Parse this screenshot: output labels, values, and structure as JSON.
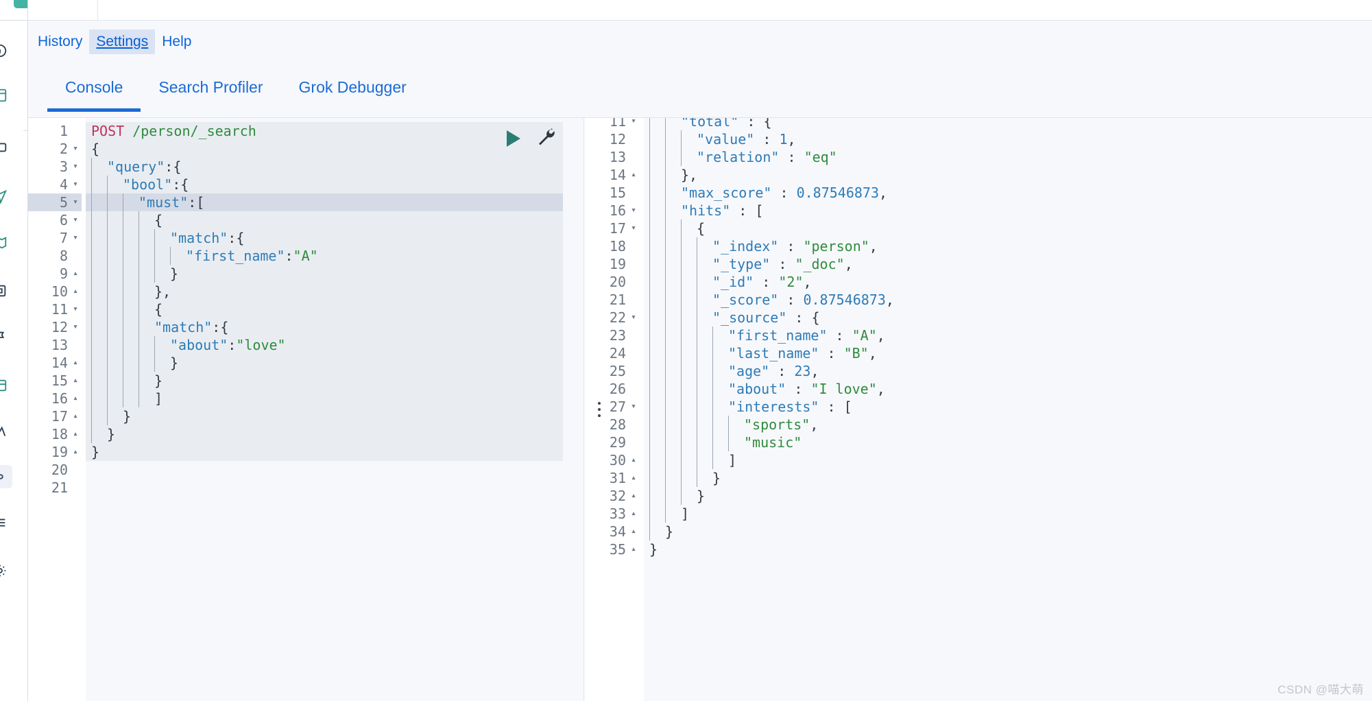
{
  "nav_rail": {
    "icons": [
      "info-icon",
      "dashboard-icon",
      "folder-icon",
      "send-icon",
      "maps-icon",
      "machine-learning-icon",
      "flag-icon",
      "canvas-icon",
      "uptime-icon",
      "devtools-icon",
      "stack-management-icon",
      "gear-icon"
    ]
  },
  "top_links": [
    {
      "label": "History",
      "selected": false
    },
    {
      "label": "Settings",
      "selected": true
    },
    {
      "label": "Help",
      "selected": false
    }
  ],
  "tabs": [
    {
      "label": "Console",
      "active": true
    },
    {
      "label": "Search Profiler",
      "active": false
    },
    {
      "label": "Grok Debugger",
      "active": false
    }
  ],
  "request_editor": {
    "actions": {
      "play": "play-icon",
      "wrench": "wrench-icon"
    },
    "highlight_line": 5,
    "lines": [
      {
        "n": 1,
        "fold": "",
        "indent": 0,
        "text": "POST /person/_search",
        "kind": "request-line"
      },
      {
        "n": 2,
        "fold": "▾",
        "indent": 0,
        "text": "{"
      },
      {
        "n": 3,
        "fold": "▾",
        "indent": 1,
        "text": "\"query\":{"
      },
      {
        "n": 4,
        "fold": "▾",
        "indent": 2,
        "text": "\"bool\":{"
      },
      {
        "n": 5,
        "fold": "▾",
        "indent": 3,
        "text": "\"must\":["
      },
      {
        "n": 6,
        "fold": "▾",
        "indent": 4,
        "text": "{"
      },
      {
        "n": 7,
        "fold": "▾",
        "indent": 5,
        "text": "\"match\":{"
      },
      {
        "n": 8,
        "fold": "",
        "indent": 6,
        "text": "\"first_name\":\"A\""
      },
      {
        "n": 9,
        "fold": "▴",
        "indent": 5,
        "text": "}"
      },
      {
        "n": 10,
        "fold": "▴",
        "indent": 4,
        "text": "},"
      },
      {
        "n": 11,
        "fold": "▾",
        "indent": 4,
        "text": "{"
      },
      {
        "n": 12,
        "fold": "▾",
        "indent": 4,
        "text": "\"match\":{"
      },
      {
        "n": 13,
        "fold": "",
        "indent": 5,
        "text": "\"about\":\"love\""
      },
      {
        "n": 14,
        "fold": "▴",
        "indent": 5,
        "text": "}"
      },
      {
        "n": 15,
        "fold": "▴",
        "indent": 4,
        "text": "}"
      },
      {
        "n": 16,
        "fold": "▴",
        "indent": 4,
        "text": "]"
      },
      {
        "n": 17,
        "fold": "▴",
        "indent": 2,
        "text": "}"
      },
      {
        "n": 18,
        "fold": "▴",
        "indent": 1,
        "text": "}"
      },
      {
        "n": 19,
        "fold": "▴",
        "indent": 0,
        "text": "}"
      },
      {
        "n": 20,
        "fold": "",
        "indent": 0,
        "text": ""
      },
      {
        "n": 21,
        "fold": "",
        "indent": 0,
        "text": ""
      }
    ]
  },
  "response_viewer": {
    "lines": [
      {
        "n": 11,
        "fold": "▾",
        "indent": 2,
        "text": "\"total\" : {",
        "clipped": true
      },
      {
        "n": 12,
        "fold": "",
        "indent": 3,
        "text": "\"value\" : 1,"
      },
      {
        "n": 13,
        "fold": "",
        "indent": 3,
        "text": "\"relation\" : \"eq\""
      },
      {
        "n": 14,
        "fold": "▴",
        "indent": 2,
        "text": "},"
      },
      {
        "n": 15,
        "fold": "",
        "indent": 2,
        "text": "\"max_score\" : 0.87546873,"
      },
      {
        "n": 16,
        "fold": "▾",
        "indent": 2,
        "text": "\"hits\" : ["
      },
      {
        "n": 17,
        "fold": "▾",
        "indent": 3,
        "text": "{"
      },
      {
        "n": 18,
        "fold": "",
        "indent": 4,
        "text": "\"_index\" : \"person\","
      },
      {
        "n": 19,
        "fold": "",
        "indent": 4,
        "text": "\"_type\" : \"_doc\","
      },
      {
        "n": 20,
        "fold": "",
        "indent": 4,
        "text": "\"_id\" : \"2\","
      },
      {
        "n": 21,
        "fold": "",
        "indent": 4,
        "text": "\"_score\" : 0.87546873,"
      },
      {
        "n": 22,
        "fold": "▾",
        "indent": 4,
        "text": "\"_source\" : {"
      },
      {
        "n": 23,
        "fold": "",
        "indent": 5,
        "text": "\"first_name\" : \"A\","
      },
      {
        "n": 24,
        "fold": "",
        "indent": 5,
        "text": "\"last_name\" : \"B\","
      },
      {
        "n": 25,
        "fold": "",
        "indent": 5,
        "text": "\"age\" : 23,"
      },
      {
        "n": 26,
        "fold": "",
        "indent": 5,
        "text": "\"about\" : \"I love\","
      },
      {
        "n": 27,
        "fold": "▾",
        "indent": 5,
        "text": "\"interests\" : ["
      },
      {
        "n": 28,
        "fold": "",
        "indent": 6,
        "text": "\"sports\","
      },
      {
        "n": 29,
        "fold": "",
        "indent": 6,
        "text": "\"music\""
      },
      {
        "n": 30,
        "fold": "▴",
        "indent": 5,
        "text": "]"
      },
      {
        "n": 31,
        "fold": "▴",
        "indent": 4,
        "text": "}"
      },
      {
        "n": 32,
        "fold": "▴",
        "indent": 3,
        "text": "}"
      },
      {
        "n": 33,
        "fold": "▴",
        "indent": 2,
        "text": "]"
      },
      {
        "n": 34,
        "fold": "▴",
        "indent": 1,
        "text": "}"
      },
      {
        "n": 35,
        "fold": "▴",
        "indent": 0,
        "text": "}",
        "clipped": true
      }
    ]
  },
  "watermark": "CSDN @喵大萌",
  "colors": {
    "accent_blue": "#1a6bd4",
    "link_blue": "#0b64dd",
    "method_pink": "#c0325a",
    "string_green": "#2e8b3d",
    "key_blue": "#2d7bb6",
    "play_teal": "#2b7d74",
    "selected_bg": "#d9e3f3",
    "editor_bg": "#e9edf2",
    "highlight_row": "#d5dbe6"
  }
}
